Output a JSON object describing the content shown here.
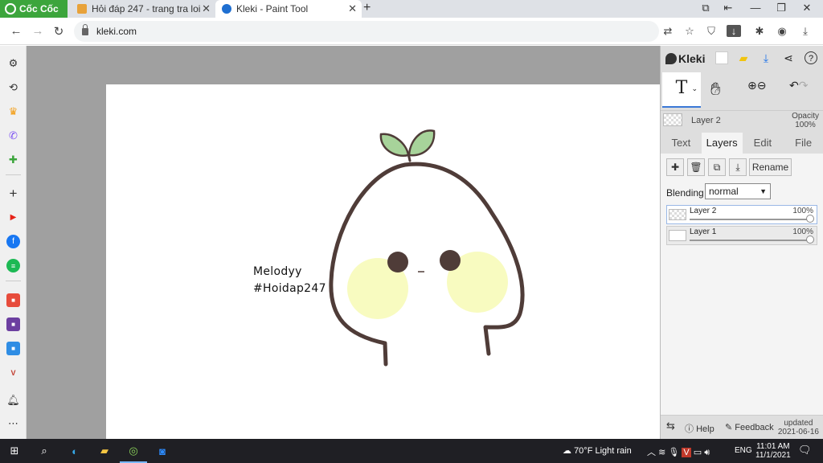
{
  "browser": {
    "brand": "Cốc Cốc",
    "tabs": [
      {
        "title": "Hỏi đáp 247 - trang tra loi"
      },
      {
        "title": "Kleki - Paint Tool"
      }
    ],
    "url": "kleki.com"
  },
  "canvas": {
    "text_lines": [
      "Melodyy",
      "#Hoidap247"
    ],
    "colors": {
      "outline": "#4f3c38",
      "leaf": "#a7d39a",
      "cheek": "#f8fbc0",
      "eye": "#4f3c38"
    }
  },
  "panel": {
    "logo": "Kleki",
    "tool_active": "T",
    "layer_preview_name": "Layer 2",
    "opacity_label": "Opacity",
    "opacity_value": "100%",
    "tabs": [
      "Text",
      "Layers",
      "Edit",
      "File"
    ],
    "active_tab": "Layers",
    "rename_label": "Rename",
    "blending_label": "Blending",
    "blending_value": "normal",
    "layers": [
      {
        "name": "Layer 2",
        "opacity": "100%"
      },
      {
        "name": "Layer 1",
        "opacity": "100%"
      }
    ],
    "footer": {
      "help": "Help",
      "feedback": "Feedback",
      "updated_label": "updated",
      "updated_date": "2021-06-16"
    }
  },
  "taskbar": {
    "weather": "70°F  Light rain",
    "lang": "ENG",
    "time": "11:01 AM",
    "date": "11/1/2021"
  }
}
